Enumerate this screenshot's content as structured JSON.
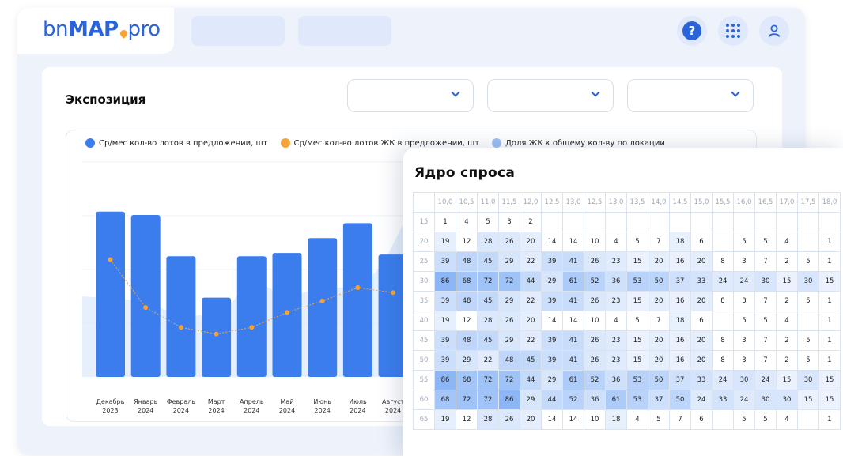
{
  "app": {
    "logo": {
      "prefix": "bn",
      "main": "MAP",
      "suffix": "pro"
    },
    "help_label": "?"
  },
  "panel": {
    "title": "Экспозиция"
  },
  "chart_data": {
    "type": "bar",
    "categories": [
      "Декабрь\n2023",
      "Январь\n2024",
      "Февраль\n2024",
      "Март\n2024",
      "Апрель\n2024",
      "Май\n2024",
      "Июнь\n2024",
      "Июль\n2024",
      "Август\n2024"
    ],
    "series": [
      {
        "name": "Ср/мес кол-во лотов в предложении, шт",
        "type": "bar",
        "color": "#3b7ded",
        "values": [
          100,
          98,
          73,
          48,
          73,
          75,
          84,
          93,
          74
        ]
      },
      {
        "name": "Ср/мес кол-во лотов ЖК в предложении, шт",
        "type": "line",
        "color": "#f5a33a",
        "values": [
          71,
          42,
          30,
          26,
          30,
          39,
          46,
          54,
          51
        ]
      },
      {
        "name": "Доля ЖК к общему кол-ву по локации",
        "type": "area",
        "color": "#9cc0f3",
        "values": []
      }
    ],
    "ylim": [
      0,
      130
    ]
  },
  "demand": {
    "title": "Ядро спроса",
    "col_headers": [
      "10,0",
      "10,5",
      "11,0",
      "11,5",
      "12,0",
      "12,5",
      "13,0",
      "12,5",
      "13,0",
      "13,5",
      "14,0",
      "14,5",
      "15,0",
      "15,5",
      "16,0",
      "16,5",
      "17,0",
      "17,5",
      "18,0"
    ],
    "rows": [
      {
        "label": "15",
        "cells": [
          "1",
          "4",
          "5",
          "3",
          "2",
          "",
          "",
          "",
          "",
          "",
          "",
          "",
          "",
          "",
          "",
          "",
          "",
          "",
          ""
        ]
      },
      {
        "label": "20",
        "cells": [
          "19",
          "12",
          "28",
          "26",
          "20",
          "14",
          "14",
          "10",
          "4",
          "5",
          "7",
          "18",
          "6",
          "",
          "5",
          "5",
          "4",
          "",
          "1"
        ]
      },
      {
        "label": "25",
        "cells": [
          "39",
          "48",
          "45",
          "29",
          "22",
          "39",
          "41",
          "26",
          "23",
          "15",
          "20",
          "16",
          "20",
          "8",
          "3",
          "7",
          "2",
          "5",
          "1"
        ]
      },
      {
        "label": "30",
        "cells": [
          "86",
          "68",
          "72",
          "72",
          "44",
          "29",
          "61",
          "52",
          "36",
          "53",
          "50",
          "37",
          "33",
          "24",
          "24",
          "30",
          "15",
          "30",
          "15"
        ]
      },
      {
        "label": "35",
        "cells": [
          "39",
          "48",
          "45",
          "29",
          "22",
          "39",
          "41",
          "26",
          "23",
          "15",
          "20",
          "16",
          "20",
          "8",
          "3",
          "7",
          "2",
          "5",
          "1"
        ]
      },
      {
        "label": "40",
        "cells": [
          "19",
          "12",
          "28",
          "26",
          "20",
          "14",
          "14",
          "10",
          "4",
          "5",
          "7",
          "18",
          "6",
          "",
          "5",
          "5",
          "4",
          "",
          "1"
        ]
      },
      {
        "label": "45",
        "cells": [
          "39",
          "48",
          "45",
          "29",
          "22",
          "39",
          "41",
          "26",
          "23",
          "15",
          "20",
          "16",
          "20",
          "8",
          "3",
          "7",
          "2",
          "5",
          "1"
        ]
      },
      {
        "label": "50",
        "cells": [
          "39",
          "29",
          "22",
          "48",
          "45",
          "39",
          "41",
          "26",
          "23",
          "15",
          "20",
          "16",
          "20",
          "8",
          "3",
          "7",
          "2",
          "5",
          "1"
        ]
      },
      {
        "label": "55",
        "cells": [
          "86",
          "68",
          "72",
          "72",
          "44",
          "29",
          "61",
          "52",
          "36",
          "53",
          "50",
          "37",
          "33",
          "24",
          "30",
          "24",
          "15",
          "30",
          "15"
        ]
      },
      {
        "label": "60",
        "cells": [
          "68",
          "72",
          "72",
          "86",
          "29",
          "44",
          "52",
          "36",
          "61",
          "53",
          "37",
          "50",
          "24",
          "33",
          "24",
          "30",
          "30",
          "15",
          "15"
        ]
      },
      {
        "label": "65",
        "cells": [
          "19",
          "12",
          "28",
          "26",
          "20",
          "14",
          "14",
          "10",
          "18",
          "4",
          "5",
          "7",
          "6",
          "",
          "5",
          "5",
          "4",
          "",
          "1"
        ]
      }
    ]
  }
}
